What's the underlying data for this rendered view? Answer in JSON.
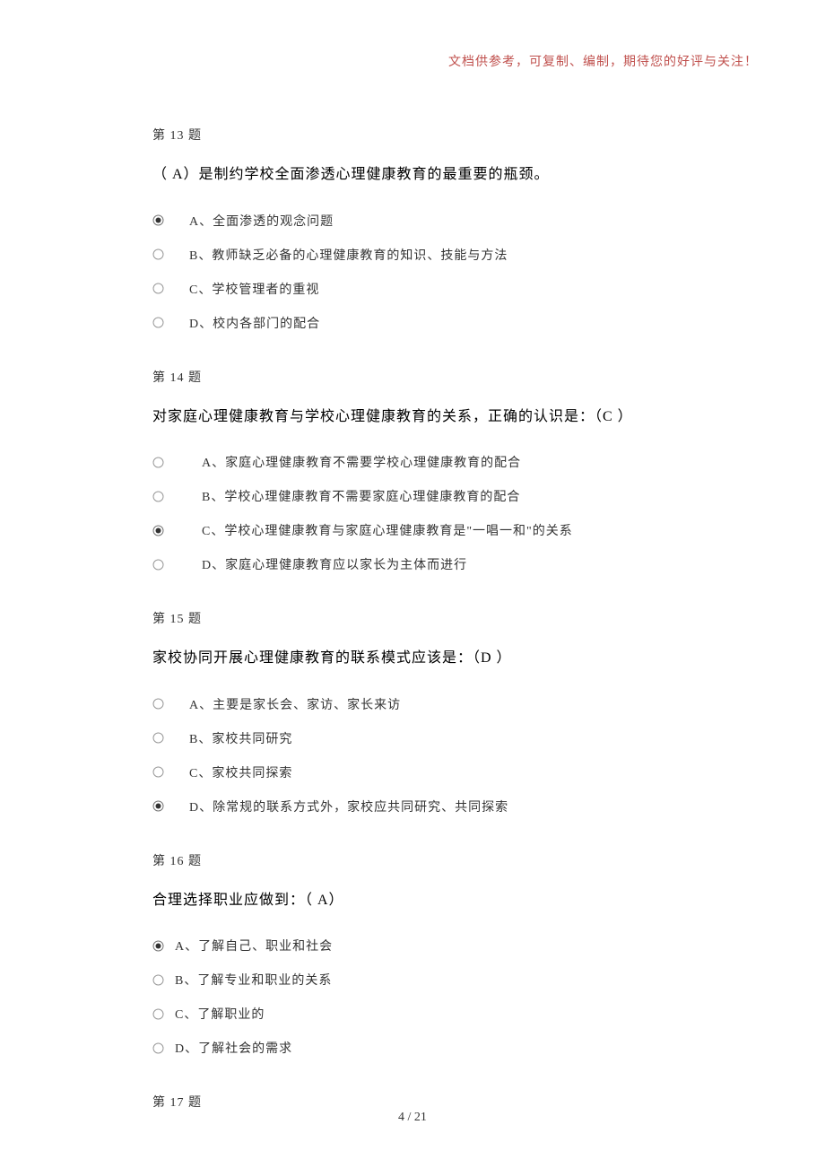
{
  "header_note": "文档供参考，可复制、编制，期待您的好评与关注！",
  "page_footer": "4 / 21",
  "questions": [
    {
      "number": "第 13 题",
      "text": "（ A）是制约学校全面渗透心理健康教育的最重要的瓶颈。",
      "options": [
        {
          "label": "A、全面渗透的观念问题",
          "selected": true
        },
        {
          "label": "B、教师缺乏必备的心理健康教育的知识、技能与方法",
          "selected": false
        },
        {
          "label": "C、学校管理者的重视",
          "selected": false
        },
        {
          "label": "D、校内各部门的配合",
          "selected": false
        }
      ]
    },
    {
      "number": "第 14 题",
      "text": "对家庭心理健康教育与学校心理健康教育的关系，正确的认识是：（C ）",
      "options": [
        {
          "label": "A、家庭心理健康教育不需要学校心理健康教育的配合",
          "selected": false
        },
        {
          "label": "B、学校心理健康教育不需要家庭心理健康教育的配合",
          "selected": false
        },
        {
          "label": "C、学校心理健康教育与家庭心理健康教育是\"一唱一和\"的关系",
          "selected": true
        },
        {
          "label": "D、家庭心理健康教育应以家长为主体而进行",
          "selected": false
        }
      ]
    },
    {
      "number": "第 15 题",
      "text": "家校协同开展心理健康教育的联系模式应该是：（D ）",
      "options": [
        {
          "label": "A、主要是家长会、家访、家长来访",
          "selected": false
        },
        {
          "label": "B、家校共同研究",
          "selected": false
        },
        {
          "label": "C、家校共同探索",
          "selected": false
        },
        {
          "label": "D、除常规的联系方式外，家校应共同研究、共同探索",
          "selected": true
        }
      ]
    },
    {
      "number": "第 16 题",
      "text": "合理选择职业应做到：（ A）",
      "options": [
        {
          "label": "A、了解自己、职业和社会",
          "selected": true
        },
        {
          "label": "B、了解专业和职业的关系",
          "selected": false
        },
        {
          "label": "C、了解职业的",
          "selected": false
        },
        {
          "label": "D、了解社会的需求",
          "selected": false
        }
      ]
    },
    {
      "number": "第 17 题",
      "text": "",
      "options": []
    }
  ]
}
